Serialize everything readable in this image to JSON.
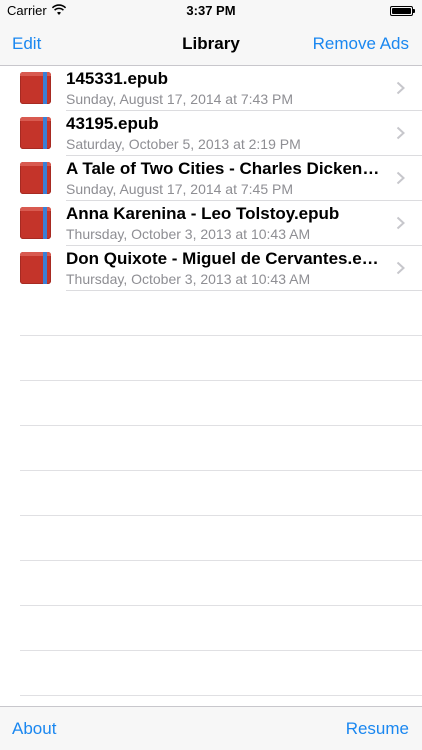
{
  "status_bar": {
    "carrier": "Carrier",
    "time": "3:37 PM",
    "battery_level": 1.0
  },
  "nav_bar": {
    "left_button": "Edit",
    "title": "Library",
    "right_button": "Remove Ads"
  },
  "books": [
    {
      "title": "145331.epub",
      "date": "Sunday, August 17, 2014 at 7:43 PM"
    },
    {
      "title": "43195.epub",
      "date": "Saturday, October 5, 2013 at 2:19 PM"
    },
    {
      "title": "A Tale of Two Cities - Charles Dickens.epub",
      "date": "Sunday, August 17, 2014 at 7:45 PM"
    },
    {
      "title": "Anna Karenina - Leo Tolstoy.epub",
      "date": "Thursday, October 3, 2013 at 10:43 AM"
    },
    {
      "title": "Don Quixote - Miguel de Cervantes.epub",
      "date": "Thursday, October 3, 2013 at 10:43 AM"
    }
  ],
  "toolbar": {
    "left_button": "About",
    "right_button": "Resume"
  },
  "colors": {
    "accent": "#1a87f0",
    "book_cover": "#c4342a",
    "book_ribbon": "#3b7fd6",
    "subtitle": "#8e8e93"
  },
  "icons": {
    "status": [
      "wifi-icon",
      "battery-icon"
    ],
    "row": [
      "book-icon",
      "chevron-right-icon"
    ]
  }
}
